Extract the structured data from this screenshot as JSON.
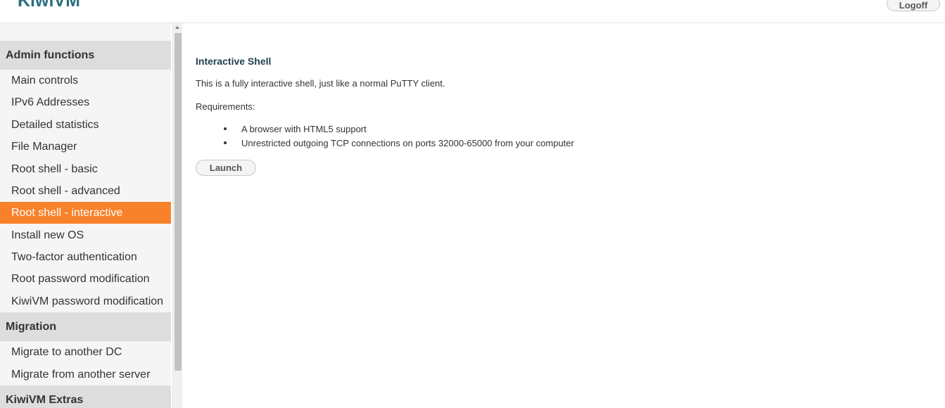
{
  "header": {
    "logo": "KiwiVM",
    "logoff_label": "Logoff"
  },
  "sidebar": {
    "sections": [
      {
        "title": "Admin functions",
        "items": [
          "Main controls",
          "IPv6 Addresses",
          "Detailed statistics",
          "File Manager",
          "Root shell - basic",
          "Root shell - advanced",
          "Root shell - interactive",
          "Install new OS",
          "Two-factor authentication",
          "Root password modification",
          "KiwiVM password modification"
        ]
      },
      {
        "title": "Migration",
        "items": [
          "Migrate to another DC",
          "Migrate from another server"
        ]
      },
      {
        "title": "KiwiVM Extras",
        "items": []
      }
    ],
    "active_item": "Root shell - interactive"
  },
  "main": {
    "title": "Interactive Shell",
    "description": "This is a fully interactive shell, just like a normal PuTTY client.",
    "requirements_label": "Requirements:",
    "requirements": [
      "A browser with HTML5 support",
      "Unrestricted outgoing TCP connections on ports 32000-65000 from your computer"
    ],
    "launch_label": "Launch"
  },
  "colors": {
    "active_item_bg": "#f7822b",
    "section_header_bg": "#dddddd",
    "logo": "#2a6f7f"
  }
}
